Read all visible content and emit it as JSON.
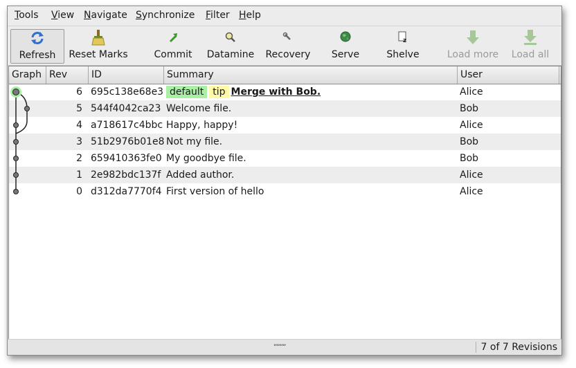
{
  "menu": [
    {
      "ul": "T",
      "rest": "ools"
    },
    {
      "ul": "V",
      "rest": "iew"
    },
    {
      "ul": "N",
      "rest": "avigate"
    },
    {
      "ul": "S",
      "rest": "ynchronize"
    },
    {
      "ul": "F",
      "rest": "ilter"
    },
    {
      "ul": "H",
      "rest": "elp"
    }
  ],
  "toolbar": {
    "refresh": "Refresh",
    "reset_marks": "Reset Marks",
    "commit": "Commit",
    "datamine": "Datamine",
    "recovery": "Recovery",
    "serve": "Serve",
    "shelve": "Shelve",
    "load_more": "Load more",
    "load_all": "Load all"
  },
  "columns": {
    "graph": "Graph",
    "rev": "Rev",
    "id": "ID",
    "summary": "Summary",
    "user": "User"
  },
  "rows": [
    {
      "rev": "6",
      "id": "695c138e68e3",
      "tags": [
        "default",
        "tip"
      ],
      "summary": "Merge with Bob.",
      "user": "Alice"
    },
    {
      "rev": "5",
      "id": "544f4042ca23",
      "summary": "Welcome file.",
      "user": "Bob"
    },
    {
      "rev": "4",
      "id": "a718617c4bbc",
      "summary": "Happy, happy!",
      "user": "Alice"
    },
    {
      "rev": "3",
      "id": "51b2976b01e8",
      "summary": "Not my file.",
      "user": "Bob"
    },
    {
      "rev": "2",
      "id": "659410363fe0",
      "summary": "My goodbye file.",
      "user": "Bob"
    },
    {
      "rev": "1",
      "id": "2e982bdc137f",
      "summary": "Added author.",
      "user": "Alice"
    },
    {
      "rev": "0",
      "id": "d312da7770f4",
      "summary": "First version of hello",
      "user": "Alice"
    }
  ],
  "status": "7 of 7 Revisions",
  "colors": {
    "branch_tag": "#a9f0a6",
    "tip_tag": "#fff9a8",
    "working_node": "#a9f0a6"
  }
}
